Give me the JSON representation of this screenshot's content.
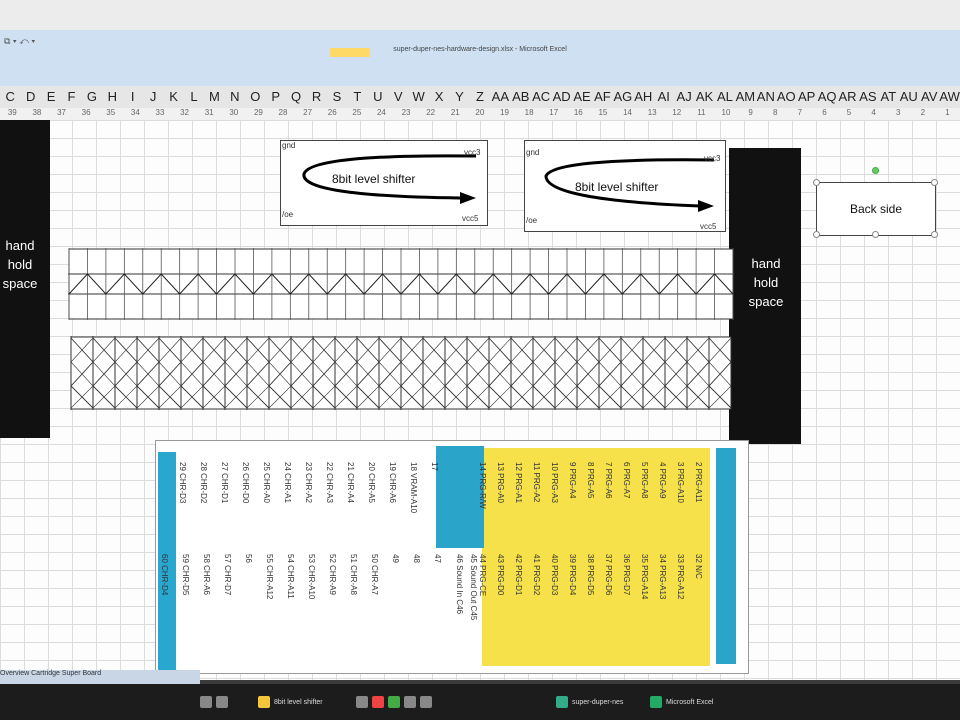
{
  "window": {
    "title": "super-duper-nes-hardware-design.xlsx - Microsoft Excel"
  },
  "columns": [
    "C",
    "D",
    "E",
    "F",
    "G",
    "H",
    "I",
    "J",
    "K",
    "L",
    "M",
    "N",
    "O",
    "P",
    "Q",
    "R",
    "S",
    "T",
    "U",
    "V",
    "W",
    "X",
    "Y",
    "Z",
    "AA",
    "AB",
    "AC",
    "AD",
    "AE",
    "AF",
    "AG",
    "AH",
    "AI",
    "AJ",
    "AK",
    "AL",
    "AM",
    "AN",
    "AO",
    "AP",
    "AQ",
    "AR",
    "AS",
    "AT",
    "AU",
    "AV",
    "AW"
  ],
  "column_numbers": [
    "39",
    "38",
    "37",
    "36",
    "35",
    "34",
    "33",
    "32",
    "31",
    "30",
    "29",
    "28",
    "27",
    "26",
    "25",
    "24",
    "23",
    "22",
    "21",
    "20",
    "19",
    "18",
    "17",
    "16",
    "15",
    "14",
    "13",
    "12",
    "11",
    "10",
    "9",
    "8",
    "7",
    "6",
    "5",
    "4",
    "3",
    "2",
    "1"
  ],
  "left_panel": {
    "line1": "hand",
    "line2": "hold",
    "line3": "space"
  },
  "right_panel": {
    "line1": "hand",
    "line2": "hold",
    "line3": "space"
  },
  "shifter1": {
    "label": "8bit level shifter",
    "gnd": "gnd",
    "vcc3": "vcc3",
    "oe": "/oe",
    "vcc5": "vcc5"
  },
  "shifter2": {
    "label": "8bit level shifter",
    "gnd": "gnd",
    "vcc3": "vcc3",
    "oe": "/oe",
    "vcc5": "vcc5"
  },
  "back_side": "Back side",
  "pin_table": {
    "col_a": [
      "29 CHR-D3",
      "28 CHR-D2",
      "27 CHR-D1",
      "26 CHR-D0",
      "25 CHR-A0",
      "24 CHR-A1",
      "23 CHR-A2",
      "22 CHR-A3",
      "21 CHR-A4",
      "20 CHR-A5",
      "19 CHR-A6",
      "18 VRAM-A10",
      "17 "
    ],
    "col_b": [
      "60 CHR-D4",
      "59 CHR-D5",
      "58 CHR-A6",
      "57 CHR-D7",
      "56 ",
      " 55 CHR-A12",
      "54 CHR-A11",
      "53 CHR-A10",
      "52 CHR-A9",
      "51 CHR-A8",
      "50 CHR-A7",
      "49 ",
      "48 ",
      "47 "
    ],
    "col_c": [
      "14 PRG-R/W",
      "13 PRG-A0",
      "12 PRG-A1",
      "11 PRG-A2",
      "10 PRG-A3",
      "9 PRG-A4",
      "8 PRG-A5",
      "7 PRG-A6",
      "6 PRG-A7",
      "5 PRG-A8",
      "4 PRG-A9",
      "3 PRG-A10",
      "2 PRG-A11"
    ],
    "col_d": [
      "44 PRG-CE",
      "43 PRG-D0",
      "42 PRG-D1",
      "41 PRG-D2",
      "40 PRG-D3",
      "39 PRG-D4",
      "38 PRG-D5",
      "37 PRG-D6",
      "36 PRG-D7",
      "35 PRG-A14",
      "34 PRG-A13",
      "33 PRG-A12",
      "32 N/C"
    ],
    "sound": [
      "46 Sound In C46",
      "45 Sound Out C45"
    ]
  },
  "sheet_tabs": "Overview  Cartridge  Super Board",
  "taskbar": {
    "item1": "8bit level shifter",
    "item2": "super-duper-nes",
    "item3": "Microsoft Excel"
  },
  "colors": {
    "yellow": "#f6e14a",
    "blue": "#2aa4c8",
    "black": "#111111"
  }
}
